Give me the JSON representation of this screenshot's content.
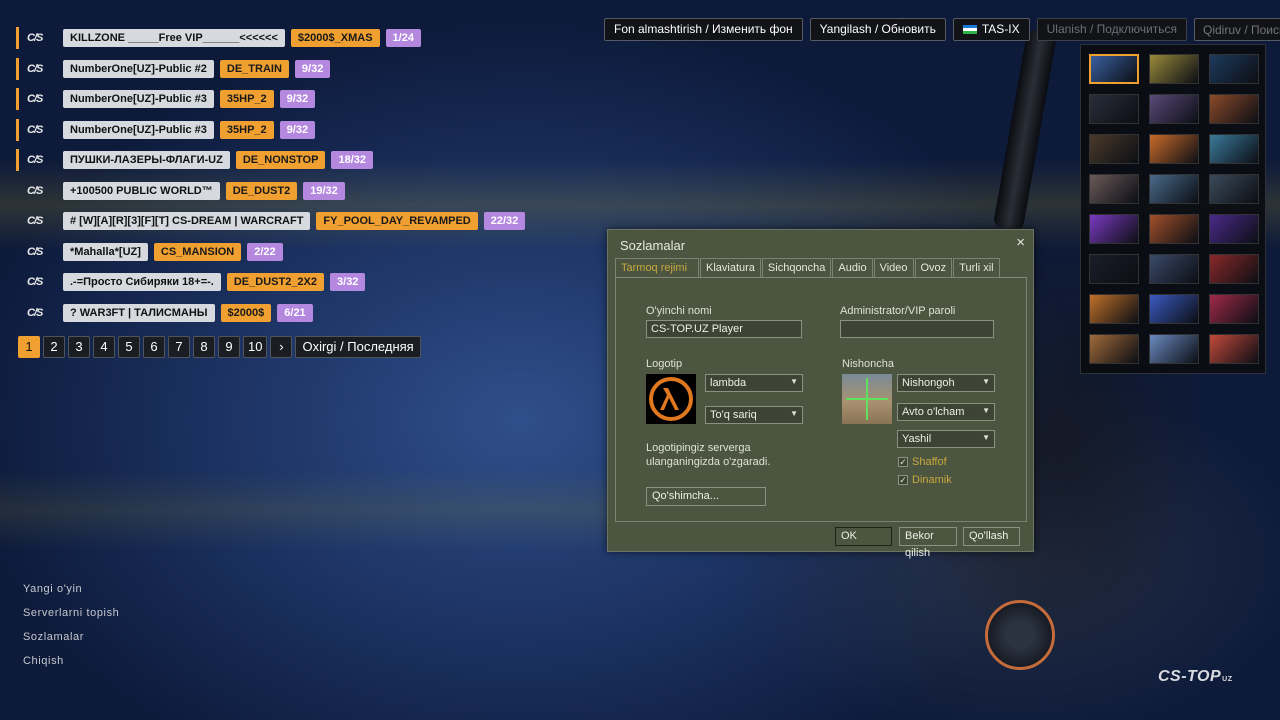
{
  "servers": [
    {
      "name": "KILLZONE _____Free VIP______<<<<<<",
      "map": "$2000$_XMAS",
      "players": "1/24",
      "highlight": true
    },
    {
      "name": "NumberOne[UZ]-Public #2",
      "map": "DE_TRAIN",
      "players": "9/32",
      "highlight": true
    },
    {
      "name": "NumberOne[UZ]-Public #3",
      "map": "35HP_2",
      "players": "9/32",
      "highlight": true
    },
    {
      "name": "NumberOne[UZ]-Public #3",
      "map": "35HP_2",
      "players": "9/32",
      "highlight": true
    },
    {
      "name": "ПУШКИ-ЛАЗЕРЫ-ФЛАГИ-UZ",
      "map": "DE_NONSTOP",
      "players": "18/32",
      "highlight": true
    },
    {
      "name": "+100500 PUBLIC WORLD™",
      "map": "DE_DUST2",
      "players": "19/32",
      "highlight": false
    },
    {
      "name": "# [W][A][R][3][F][T] CS-DREAM | WARCRAFT",
      "map": "FY_POOL_DAY_REVAMPED",
      "players": "22/32",
      "highlight": false
    },
    {
      "name": "*Mahalla*[UZ]",
      "map": "CS_MANSION",
      "players": "2/22",
      "highlight": false
    },
    {
      "name": ".-=Просто Сибиряки 18+=-.",
      "map": "DE_DUST2_2X2",
      "players": "3/32",
      "highlight": false
    },
    {
      "name": "? WAR3FT | ТАЛИСМАНЫ",
      "map": "$2000$",
      "players": "6/21",
      "highlight": false
    }
  ],
  "server_logo_text": "C/S",
  "pagination": {
    "pages": [
      "1",
      "2",
      "3",
      "4",
      "5",
      "6",
      "7",
      "8",
      "9",
      "10"
    ],
    "active_page": "1",
    "next_label": "›",
    "last_label": "Oxirgi / Последняя"
  },
  "toolbar": {
    "change_bg_label": "Fon almashtirish / Изменить фон",
    "refresh_label": "Yangilash / Обновить",
    "tasix_label": "TAS-IX",
    "connect_label": "Ulanish / Подключиться",
    "search_placeholder": "Qidiruv / Поиск..."
  },
  "gallery_thumbs": [
    "#3a5fa0",
    "#9a8a3a",
    "#1e3a5c",
    "#2a2e3a",
    "#5a4a7a",
    "#8a4a2a",
    "#4a3a2a",
    "#c86a2a",
    "#3a7a9a",
    "#6a5a5a",
    "#4a6a8a",
    "#3a4a5a",
    "#7a3ac0",
    "#a0502a",
    "#4a2a8a",
    "#1a1e28",
    "#3a4a6a",
    "#8a2a2a",
    "#c0702a",
    "#3a5ac0",
    "#a02a4a",
    "#a06a3a",
    "#6a8ac0",
    "#c04a3a"
  ],
  "dialog": {
    "title": "Sozlamalar",
    "close": "×",
    "tabs": [
      "Tarmoq rejimi",
      "Klaviatura",
      "Sichqoncha",
      "Audio",
      "Video",
      "Ovoz",
      "Turli xil"
    ],
    "active_tab": 0,
    "player_name_label": "O'yinchi nomi",
    "player_name_value": "CS-TOP.UZ Player",
    "admin_pass_label": "Administrator/VIP paroli",
    "admin_pass_value": "",
    "logo_label": "Logotip",
    "logo_select": "lambda",
    "logo_color_select": "To'q sariq",
    "logo_note": "Logotipingiz serverga ulanganingizda o'zgaradi.",
    "spray_label": "Nishoncha",
    "spray_select": "Nishongoh",
    "spray_size_select": "Avto o'lcham",
    "spray_color_select": "Yashil",
    "transparent_label": "Shaffof",
    "transparent_checked": "✓",
    "dynamic_label": "Dinamik",
    "dynamic_checked": "✓",
    "advanced_label": "Qo'shimcha...",
    "ok_label": "OK",
    "cancel_label": "Bekor qilish",
    "apply_label": "Qo'llash"
  },
  "main_menu": [
    "Yangi o'yin",
    "Serverlarni topish",
    "Sozlamalar",
    "Chiqish"
  ],
  "brand": {
    "name": "CS-TOP",
    "suffix": "UZ"
  },
  "colors": {
    "accent_orange": "#f0a030",
    "player_purple": "#b488df",
    "dialog_bg": "#4c5540",
    "tab_active": "#c8a83e"
  }
}
